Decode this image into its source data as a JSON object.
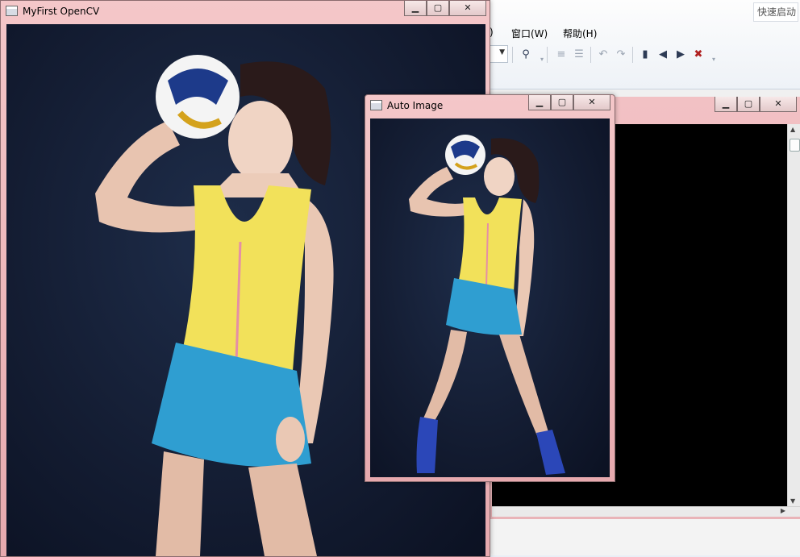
{
  "ide": {
    "quick_launch": "快速启动",
    "menu_fragment": ")",
    "menu_window": "窗口(W)",
    "menu_help": "帮助(H)"
  },
  "windows": {
    "main": {
      "title": "MyFirst OpenCV"
    },
    "auto": {
      "title": "Auto Image"
    }
  },
  "icons": {
    "minimize": "minimize-icon",
    "maximize": "maximize-icon",
    "close": "close-icon",
    "window": "window-icon"
  },
  "colors": {
    "frame": "#e9b4b8",
    "console_bg": "#000000",
    "photo_bg": "#141d33",
    "dress_yellow": "#f2e15a",
    "skirt_blue": "#2f9ed1",
    "boots_blue": "#2b47b8"
  }
}
